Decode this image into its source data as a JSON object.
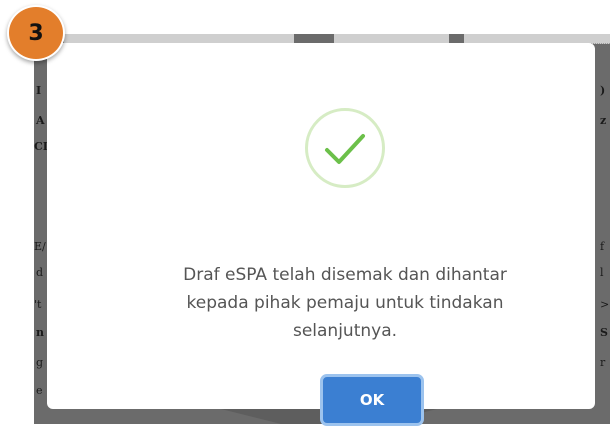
{
  "step_badge": {
    "number": "3",
    "color": "#e37e2b"
  },
  "background_document": {
    "left_margin_letters": [
      "I",
      "A",
      "CI",
      "E/",
      "d",
      "'t",
      "n",
      "g",
      "e"
    ],
    "right_margin_letters": [
      ")",
      "z",
      "f",
      "l",
      ">",
      "S",
      "r"
    ]
  },
  "dialog": {
    "icon": "check-circle-icon",
    "message": "Draf eSPA telah disemak dan dihantar kepada pihak pemaju untuk tindakan selanjutnya.",
    "ok_label": "OK",
    "colors": {
      "accent": "#3b7fd2",
      "success": "#6cc04a"
    }
  }
}
